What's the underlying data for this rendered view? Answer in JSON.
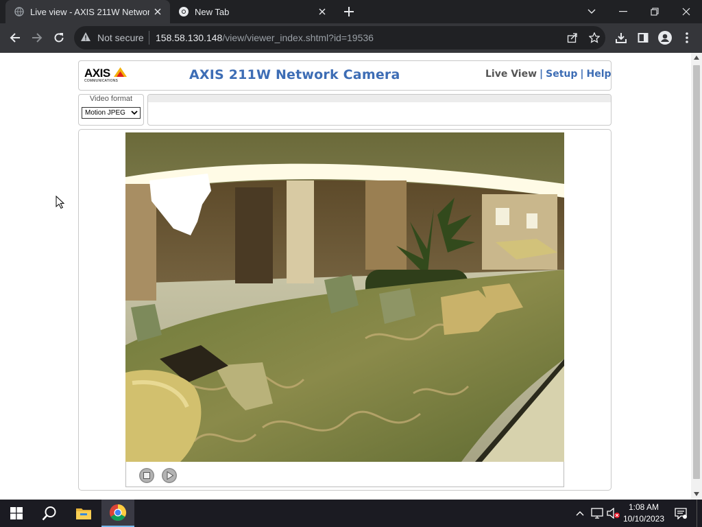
{
  "browser": {
    "tabs": [
      {
        "title": "Live view - AXIS 211W Network C",
        "active": true
      },
      {
        "title": "New Tab",
        "active": false
      }
    ],
    "security_label": "Not secure",
    "url_host": "158.58.130.148",
    "url_path": "/view/viewer_index.shtml?id=19536"
  },
  "camera_page": {
    "logo_text": "AXIS",
    "logo_subtext": "COMMUNICATIONS",
    "title": "AXIS 211W Network Camera",
    "nav": {
      "live_view": "Live View",
      "separator": "|",
      "setup": "Setup",
      "help": "Help"
    },
    "video_format": {
      "label": "Video format",
      "selected": "Motion JPEG"
    },
    "controls": [
      "stop-icon",
      "play-icon"
    ]
  },
  "taskbar": {
    "time": "1:08 AM",
    "date": "10/10/2023",
    "apps": [
      "windows-start-icon",
      "search-icon",
      "file-explorer-icon",
      "chrome-icon"
    ]
  },
  "colors": {
    "axis_blue": "#3d6db5",
    "browser_dark": "#202124",
    "browser_toolbar": "#35363a"
  }
}
